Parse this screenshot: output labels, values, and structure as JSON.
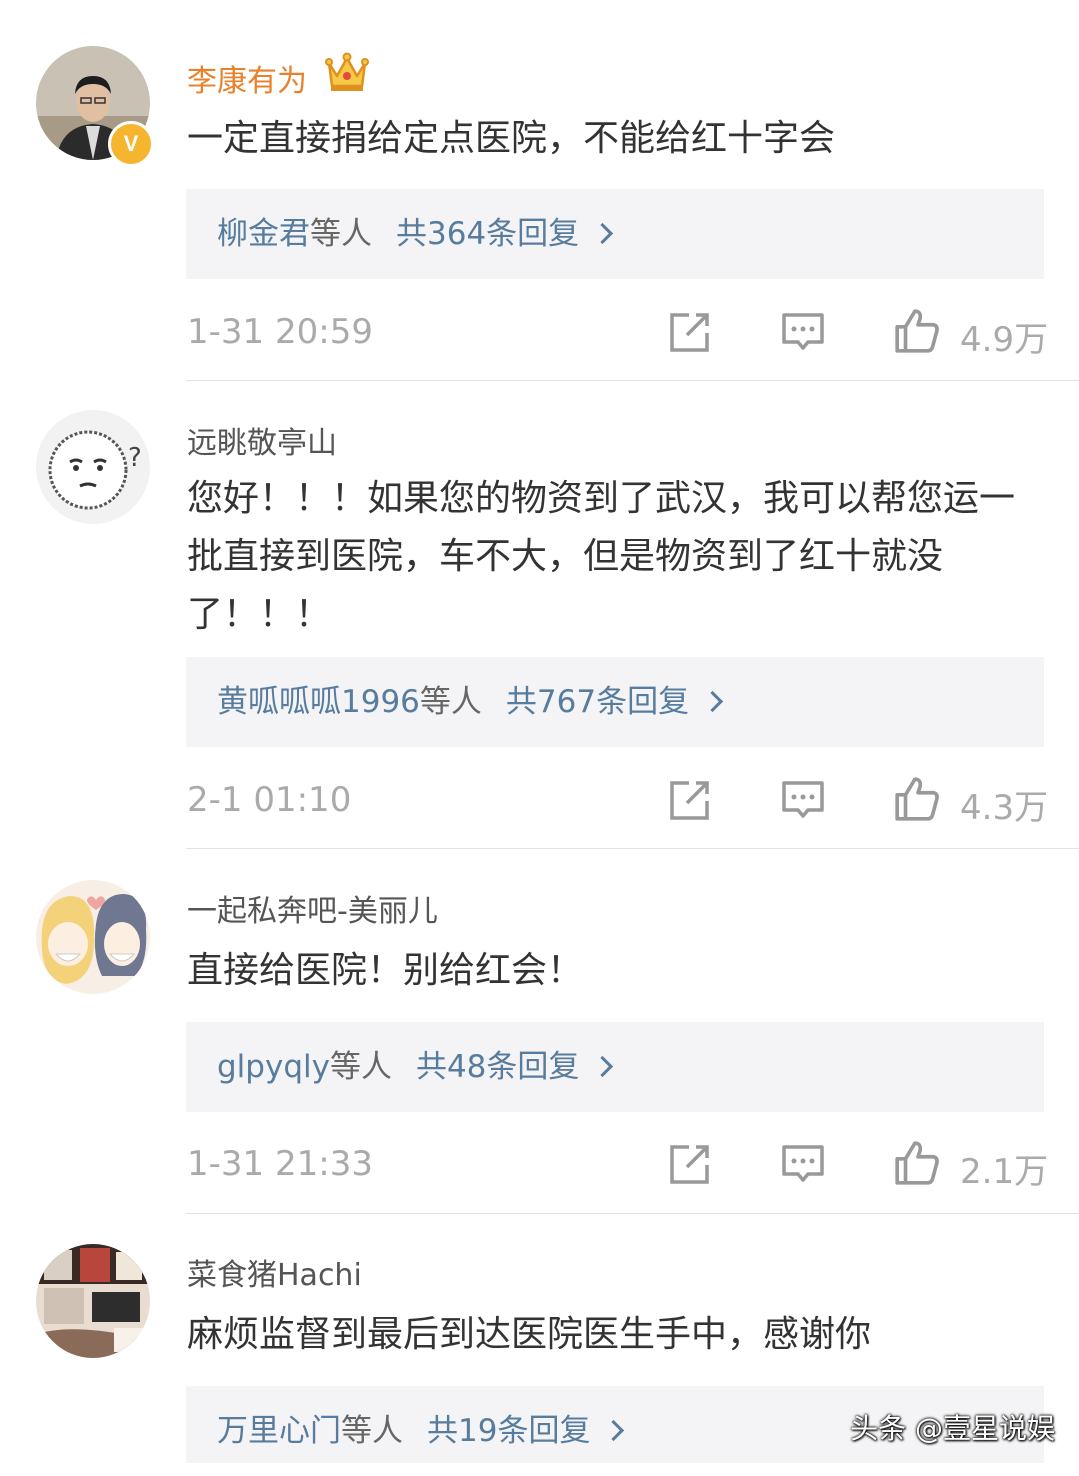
{
  "comments": [
    {
      "username": "李康有为",
      "text": "一定直接捐给定点医院，不能给红十字会",
      "reply_users": "柳金君",
      "reply_suffix": "等人",
      "reply_count": "共364条回复",
      "time": "1-31 20:59",
      "likes": "4.9万"
    },
    {
      "username": "远眺敬亭山",
      "text": "您好！！！如果您的物资到了武汉，我可以帮您运一批直接到医院，车不大，但是物资到了红十就没了！！！",
      "reply_users": "黄呱呱呱1996",
      "reply_suffix": "等人",
      "reply_count": "共767条回复",
      "time": "2-1 01:10",
      "likes": "4.3万"
    },
    {
      "username": "一起私奔吧-美丽儿",
      "text": "直接给医院！别给红会！",
      "reply_users": "glpyqly",
      "reply_suffix": "等人",
      "reply_count": "共48条回复",
      "time": "1-31 21:33",
      "likes": "2.1万"
    },
    {
      "username": "菜食猪Hachi",
      "text": "麻烦监督到最后到达医院医生手中，感谢你",
      "reply_users": "万里心门",
      "reply_suffix": "等人",
      "reply_count": "共19条回复"
    }
  ],
  "verified_badge": "V",
  "watermark": "头条 @壹星说娱",
  "icons": [
    "share-icon",
    "comment-icon",
    "like-icon",
    "crown-icon",
    "verified-icon",
    "chevron-right-icon"
  ],
  "colors": {
    "link": "#587c9d",
    "vip_name": "#e8812c",
    "reply_bg": "#f4f4f6",
    "meta": "#aaaaaa"
  }
}
